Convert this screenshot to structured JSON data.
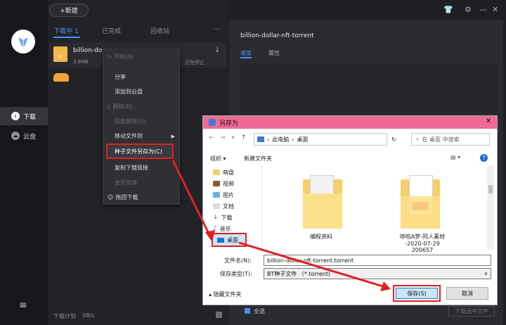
{
  "app": {
    "new_button": "+新建",
    "tabs": [
      {
        "label": "下载中 1"
      },
      {
        "label": "已完成"
      },
      {
        "label": "回收站"
      }
    ],
    "more_label": "···",
    "sidebar": {
      "items": [
        {
          "label": "下载",
          "icon": "download-icon"
        },
        {
          "label": "云盘",
          "icon": "cloud-icon"
        }
      ]
    },
    "task": {
      "name": "billion-do",
      "size": "3.8MB",
      "status": "正在停止",
      "badge": "BT"
    },
    "footer": {
      "plan": "下载计划",
      "speed": "0B/s"
    },
    "detail": {
      "title": "billion-dollar-nft-torrent",
      "tabs": [
        {
          "label": "速度"
        },
        {
          "label": "属性"
        }
      ],
      "select_all": "全选",
      "download_selected": "下载选中文件"
    }
  },
  "context_menu": {
    "items": [
      {
        "label": "开始(S)",
        "disabled": true
      },
      {
        "label": "分享",
        "disabled": false
      },
      {
        "label": "添加到云盘",
        "disabled": false
      },
      {
        "label": "删除(D)",
        "disabled": true
      },
      {
        "label": "彻底删除(Q)",
        "disabled": true
      },
      {
        "label": "移动文件到",
        "disabled": false
      },
      {
        "label": "种子文件另存为(C)",
        "disabled": false,
        "highlighted": true
      },
      {
        "label": "复制下载链接",
        "disabled": false
      },
      {
        "label": "会员加速",
        "disabled": true
      },
      {
        "label": "拖团下载",
        "disabled": false
      }
    ]
  },
  "save_dialog": {
    "title": "另存为",
    "breadcrumb": [
      "此电脑",
      "桌面"
    ],
    "search_placeholder": "在 桌面 中搜索",
    "organize": "组织",
    "new_folder": "新建文件夹",
    "tree": [
      {
        "label": "萌盘"
      },
      {
        "label": "视频"
      },
      {
        "label": "图片"
      },
      {
        "label": "文档"
      },
      {
        "label": "下载"
      },
      {
        "label": "音乐"
      },
      {
        "label": "桌面"
      }
    ],
    "files": [
      {
        "name": "编程资料"
      },
      {
        "name": "哆啦A梦-同人素材",
        "name2": "-2020-07-29 200657"
      }
    ],
    "filename_label": "文件名(N):",
    "filename_value": "billion-dollar-nft-torrent.torrent",
    "filetype_label": "保存类型(T):",
    "filetype_value": "BT种子文件 （*.torrent)",
    "hide_folders": "隐藏文件夹",
    "save_button": "保存(S)",
    "cancel_button": "取消"
  },
  "colors": {
    "accent": "#4d8df7",
    "highlight_red": "#e02020",
    "dialog_titlebar": "#f06a95"
  }
}
